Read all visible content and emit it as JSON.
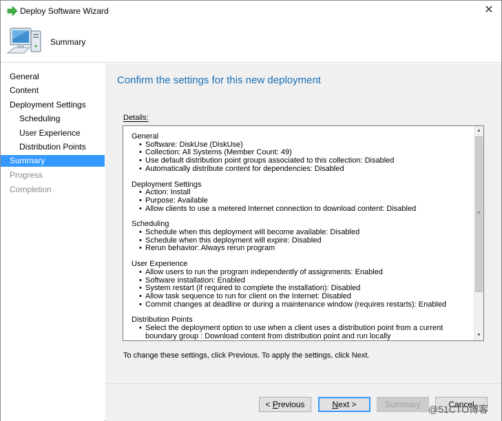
{
  "window": {
    "title": "Deploy Software Wizard",
    "close_glyph": "✕"
  },
  "header": {
    "title": "Summary",
    "icon": "computer-icon"
  },
  "nav": {
    "items": [
      {
        "label": "General",
        "state": "normal",
        "level": 0
      },
      {
        "label": "Content",
        "state": "normal",
        "level": 0
      },
      {
        "label": "Deployment Settings",
        "state": "normal",
        "level": 0
      },
      {
        "label": "Scheduling",
        "state": "normal",
        "level": 1
      },
      {
        "label": "User Experience",
        "state": "normal",
        "level": 1
      },
      {
        "label": "Distribution Points",
        "state": "normal",
        "level": 1
      },
      {
        "label": "Summary",
        "state": "active",
        "level": 0
      },
      {
        "label": "Progress",
        "state": "disabled",
        "level": 0
      },
      {
        "label": "Completion",
        "state": "disabled",
        "level": 0
      }
    ]
  },
  "main": {
    "heading": "Confirm the settings for this new deployment",
    "details_label": "Details:",
    "sections": [
      {
        "title": "General",
        "lines": [
          "Software: DiskUse (DiskUse)",
          "Collection: All Systems (Member Count: 49)",
          "Use default distribution point groups associated to this collection: Disabled",
          "Automatically distribute content for dependencies: Disabled"
        ]
      },
      {
        "title": "Deployment Settings",
        "lines": [
          "Action: Install",
          "Purpose: Available",
          "Allow clients to use a metered Internet connection to download content: Disabled"
        ]
      },
      {
        "title": "Scheduling",
        "lines": [
          "Schedule when this deployment will become available: Disabled",
          "Schedule when this deployment will expire: Disabled",
          "Rerun behavior: Always rerun program"
        ]
      },
      {
        "title": "User Experience",
        "lines": [
          "Allow users to run the program independently of assignments: Enabled",
          "Software installation: Enabled",
          "System restart (if required to complete the installation): Disabled",
          "Allow task sequence to run for client on the Internet: Disabled",
          "Commit changes at deadline or during a maintenance window (requires restarts): Enabled"
        ]
      },
      {
        "title": "Distribution Points",
        "lines": [
          "Select the deployment option to use when a client uses a distribution point from a current boundary group : Download content from distribution point and run locally"
        ]
      }
    ],
    "hint": "To change these settings, click Previous. To apply the settings, click Next."
  },
  "footer": {
    "previous_mnemonic": "P",
    "previous_rest": "revious",
    "previous_prefix": "< ",
    "next_mnemonic": "N",
    "next_rest": "ext >",
    "summary_label": "Summary",
    "cancel_label": "Cancel"
  },
  "watermark": "@51CTO博客",
  "colors": {
    "accent": "#3399ff",
    "heading": "#1a6fb5",
    "panel": "#f0f0f0"
  }
}
